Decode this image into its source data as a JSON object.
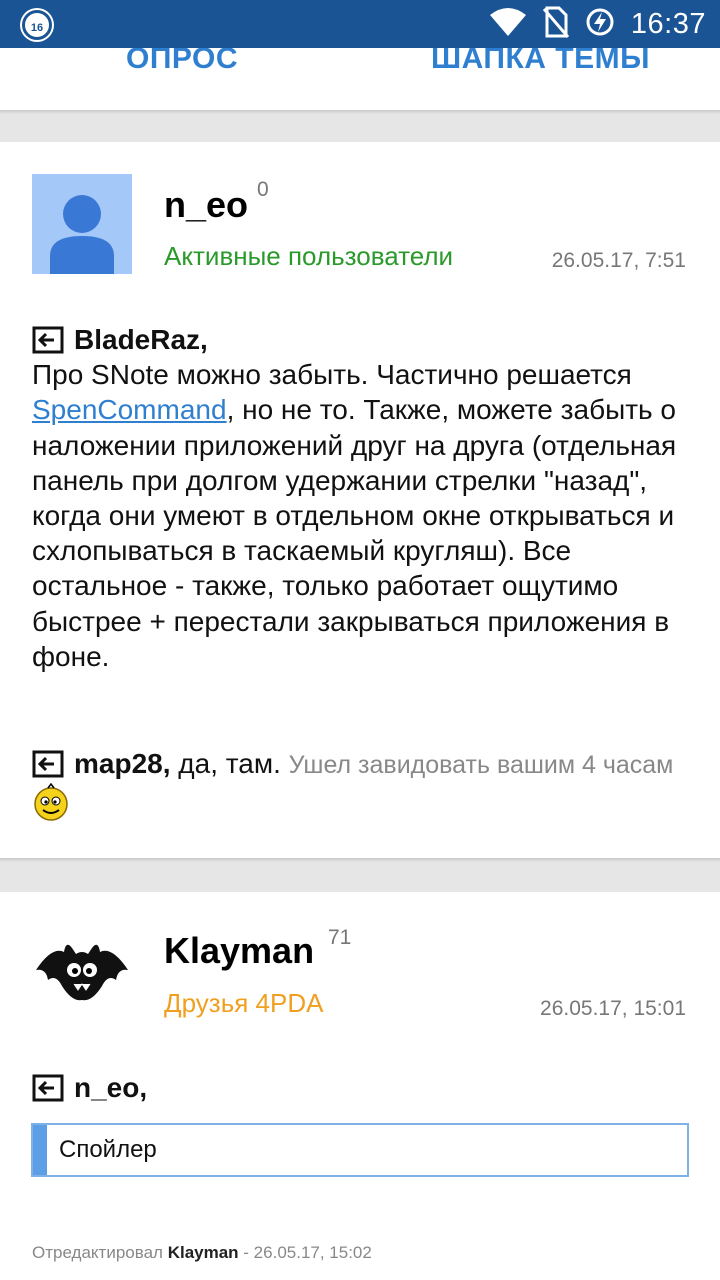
{
  "status_bar": {
    "notification_badge": "16",
    "time": "16:37",
    "icons": [
      "wifi-icon",
      "no-sim-icon",
      "battery-charging-icon"
    ]
  },
  "tabs": [
    {
      "label": "ОПРОС"
    },
    {
      "label": "ШАПКА ТЕМЫ"
    }
  ],
  "posts": [
    {
      "author": "n_eo",
      "reputation": "0",
      "group": "Активные пользователи",
      "group_color": "#2a9a2a",
      "date": "26.05.17, 7:51",
      "reply_1_to": "BladeRaz,",
      "reply_1_text_a": "Про SNote можно забыть. Частично решается",
      "reply_1_link": "SpenCommand",
      "reply_1_text_b": ", но не то. Также, можете забыть о наложении приложений друг на друга (отдельная панель при долгом удержании стрелки \"назад\", когда они умеют в отдельном окне открываться и схлопываться в таскаемый кругляш). Все остальное - также, только работает ощутимо быстрее + перестали закрываться приложения в фоне.",
      "reply_2_to": "map28,",
      "reply_2_text": " да, там.",
      "reply_2_gray": "Ушел завидовать вашим 4 часам"
    },
    {
      "author": "Klayman",
      "reputation": "71",
      "group": "Друзья 4PDA",
      "group_color": "#f0a020",
      "date": "26.05.17, 15:01",
      "reply_to": "n_eo,",
      "spoiler_label": "Спойлер",
      "edited_prefix": "Отредактировал",
      "edited_by": "Klayman",
      "edited_suffix": "- 26.05.17, 15:02"
    }
  ],
  "colors": {
    "status_bar": "#1a5494",
    "accent": "#2f7fd0"
  }
}
